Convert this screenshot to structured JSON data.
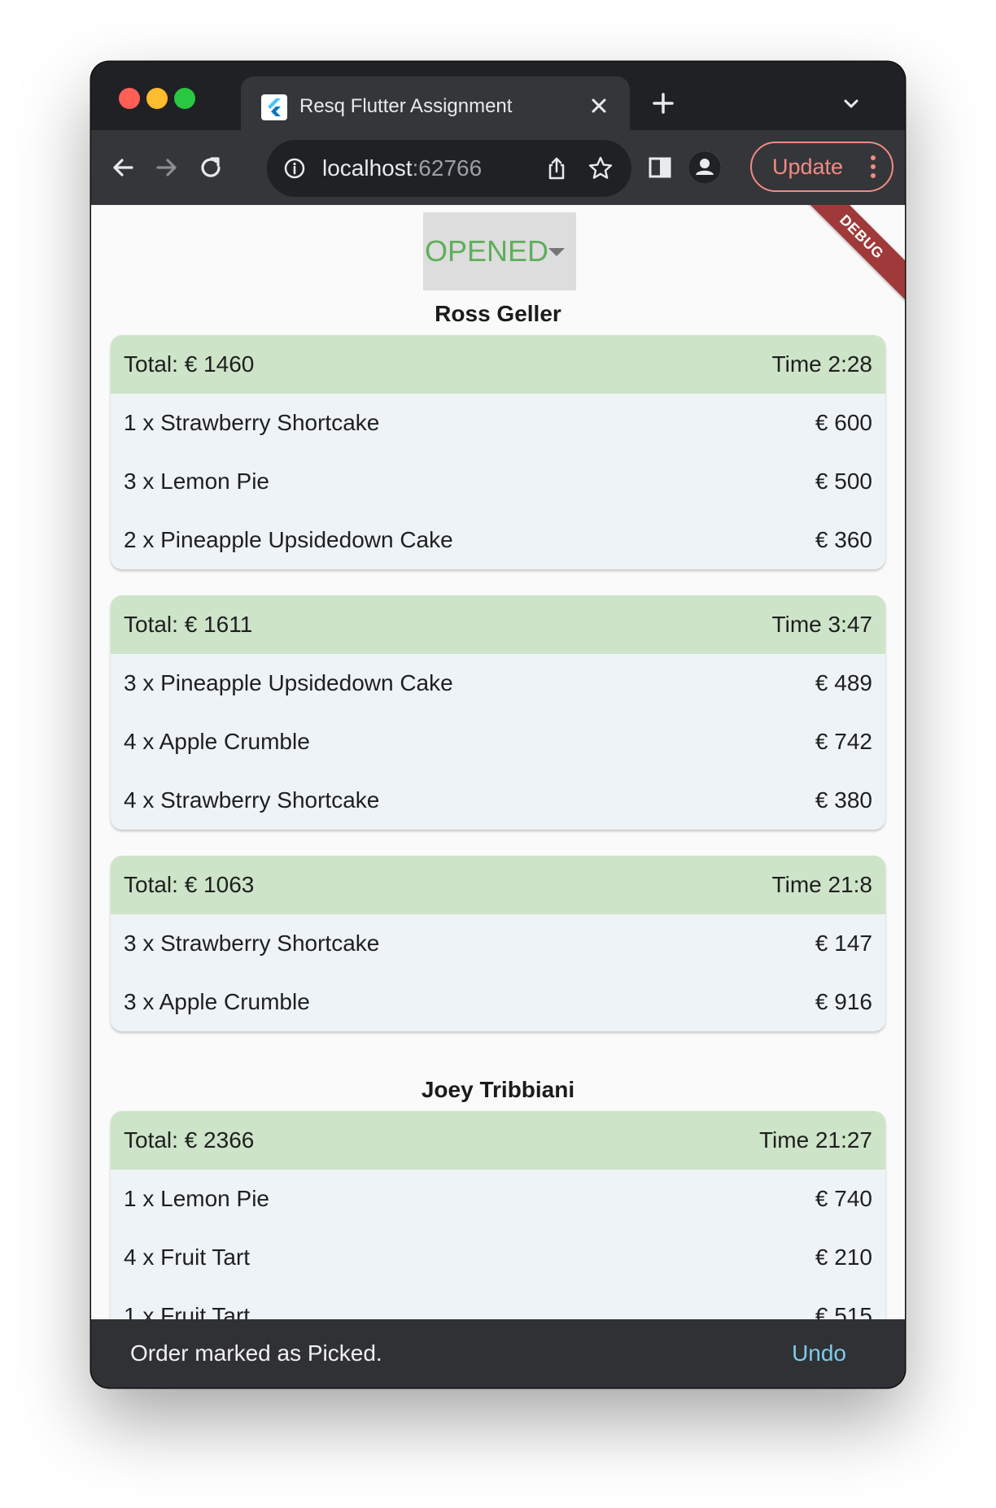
{
  "browser": {
    "tab_title": "Resq Flutter Assignment",
    "url_host": "localhost",
    "url_port": ":62766",
    "update_label": "Update"
  },
  "page": {
    "status_filter": "OPENED",
    "debug_banner": "DEBUG",
    "customers": [
      {
        "name": "Ross Geller",
        "orders": [
          {
            "total": "Total: € 1460",
            "time": "Time 2:28",
            "items": [
              {
                "label": "1 x Strawberry Shortcake",
                "price": "€ 600"
              },
              {
                "label": "3 x Lemon Pie",
                "price": "€ 500"
              },
              {
                "label": "2 x Pineapple Upsidedown Cake",
                "price": "€ 360"
              }
            ]
          },
          {
            "total": "Total: € 1611",
            "time": "Time 3:47",
            "items": [
              {
                "label": "3 x Pineapple Upsidedown Cake",
                "price": "€ 489"
              },
              {
                "label": "4 x Apple Crumble",
                "price": "€ 742"
              },
              {
                "label": "4 x Strawberry Shortcake",
                "price": "€ 380"
              }
            ]
          },
          {
            "total": "Total: € 1063",
            "time": "Time 21:8",
            "items": [
              {
                "label": "3 x Strawberry Shortcake",
                "price": "€ 147"
              },
              {
                "label": "3 x Apple Crumble",
                "price": "€ 916"
              }
            ]
          }
        ]
      },
      {
        "name": "Joey Tribbiani",
        "orders": [
          {
            "total": "Total: € 2366",
            "time": "Time 21:27",
            "items": [
              {
                "label": "1 x Lemon Pie",
                "price": "€ 740"
              },
              {
                "label": "4 x Fruit Tart",
                "price": "€ 210"
              },
              {
                "label": "1 x Fruit Tart",
                "price": "€ 515"
              }
            ]
          }
        ]
      }
    ]
  },
  "snackbar": {
    "message": "Order marked as Picked.",
    "action": "Undo"
  },
  "colors": {
    "status_green": "#5fae5a",
    "card_header": "#cde4c8",
    "card_body": "#eef3f7",
    "update_accent": "#f28b82",
    "snackbar_action": "#7fcbea"
  }
}
